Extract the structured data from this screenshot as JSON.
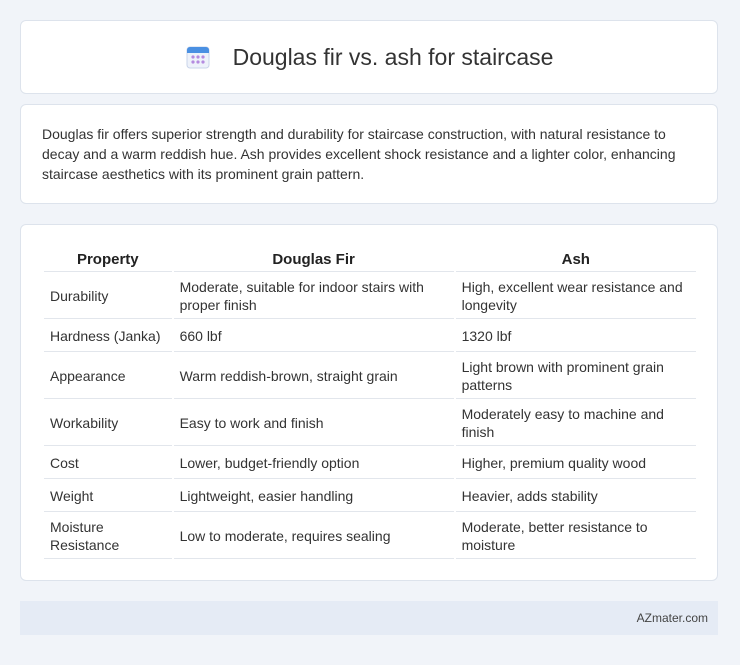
{
  "header": {
    "title": "Douglas fir vs. ash for staircase",
    "icon": "calendar-icon",
    "icon_colors": {
      "top": "#4a90e2",
      "body": "#eef2fa",
      "dots": "#b58be0"
    }
  },
  "summary": {
    "text": "Douglas fir offers superior strength and durability for staircase construction, with natural resistance to decay and a warm reddish hue. Ash provides excellent shock resistance and a lighter color, enhancing staircase aesthetics with its prominent grain pattern."
  },
  "table": {
    "headers": [
      "Property",
      "Douglas Fir",
      "Ash"
    ],
    "rows": [
      [
        "Durability",
        "Moderate, suitable for indoor stairs with proper finish",
        "High, excellent wear resistance and longevity"
      ],
      [
        "Hardness (Janka)",
        "660 lbf",
        "1320 lbf"
      ],
      [
        "Appearance",
        "Warm reddish-brown, straight grain",
        "Light brown with prominent grain patterns"
      ],
      [
        "Workability",
        "Easy to work and finish",
        "Moderately easy to machine and finish"
      ],
      [
        "Cost",
        "Lower, budget-friendly option",
        "Higher, premium quality wood"
      ],
      [
        "Weight",
        "Lightweight, easier handling",
        "Heavier, adds stability"
      ],
      [
        "Moisture Resistance",
        "Low to moderate, requires sealing",
        "Moderate, better resistance to moisture"
      ]
    ]
  },
  "footer": {
    "brand": "AZmater.com"
  }
}
